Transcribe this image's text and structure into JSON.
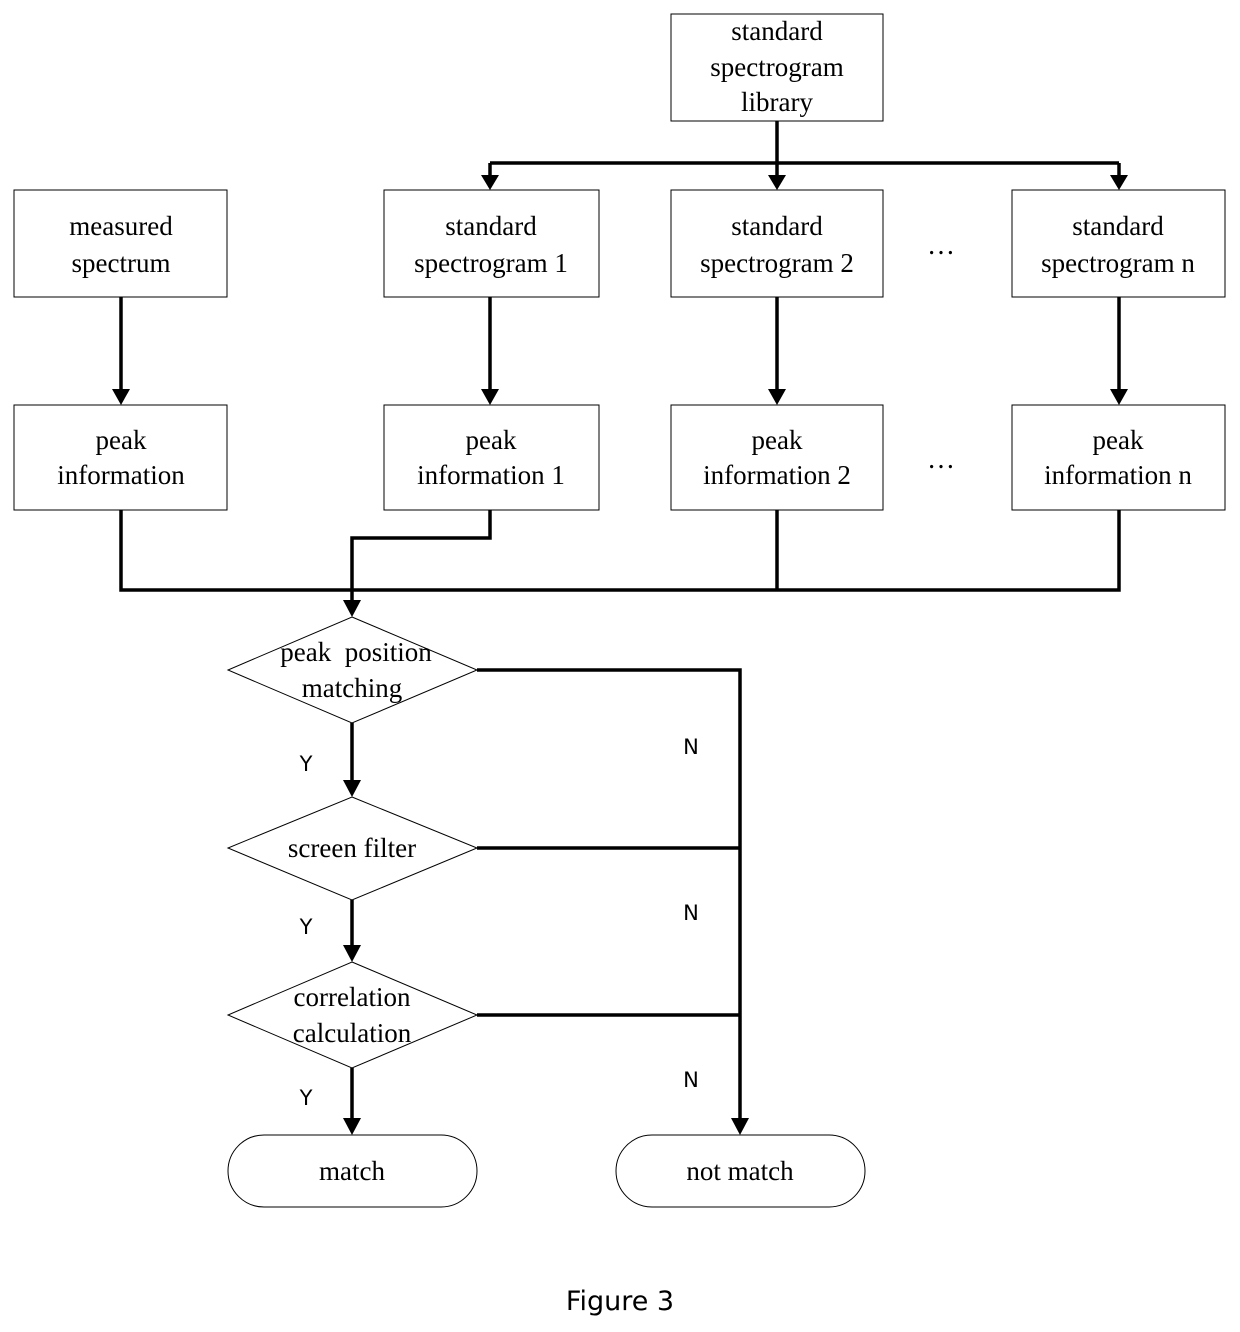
{
  "diagram": {
    "nodes": {
      "library": {
        "lines": [
          "standard",
          "spectrogram",
          "library"
        ]
      },
      "measured": {
        "lines": [
          "measured",
          "spectrum"
        ]
      },
      "std1": {
        "lines": [
          "standard",
          "spectrogram 1"
        ]
      },
      "std2": {
        "lines": [
          "standard",
          "spectrogram 2"
        ]
      },
      "stdn": {
        "lines": [
          "standard",
          "spectrogram n"
        ]
      },
      "peak0": {
        "lines": [
          "peak",
          "information"
        ]
      },
      "peak1": {
        "lines": [
          "peak",
          "information 1"
        ]
      },
      "peak2": {
        "lines": [
          "peak",
          "information 2"
        ]
      },
      "peakn": {
        "lines": [
          "peak",
          "information n"
        ]
      },
      "decision1": {
        "lines": [
          "peak  position",
          "matching"
        ]
      },
      "decision2": {
        "lines": [
          "screen filter"
        ]
      },
      "decision3": {
        "lines": [
          "correlation",
          "calculation"
        ]
      },
      "match": {
        "lines": [
          "match"
        ]
      },
      "notmatch": {
        "lines": [
          "not match"
        ]
      }
    },
    "ellipsis": "…",
    "yes_label": "Y",
    "no_label": "N",
    "caption": "Figure 3"
  }
}
